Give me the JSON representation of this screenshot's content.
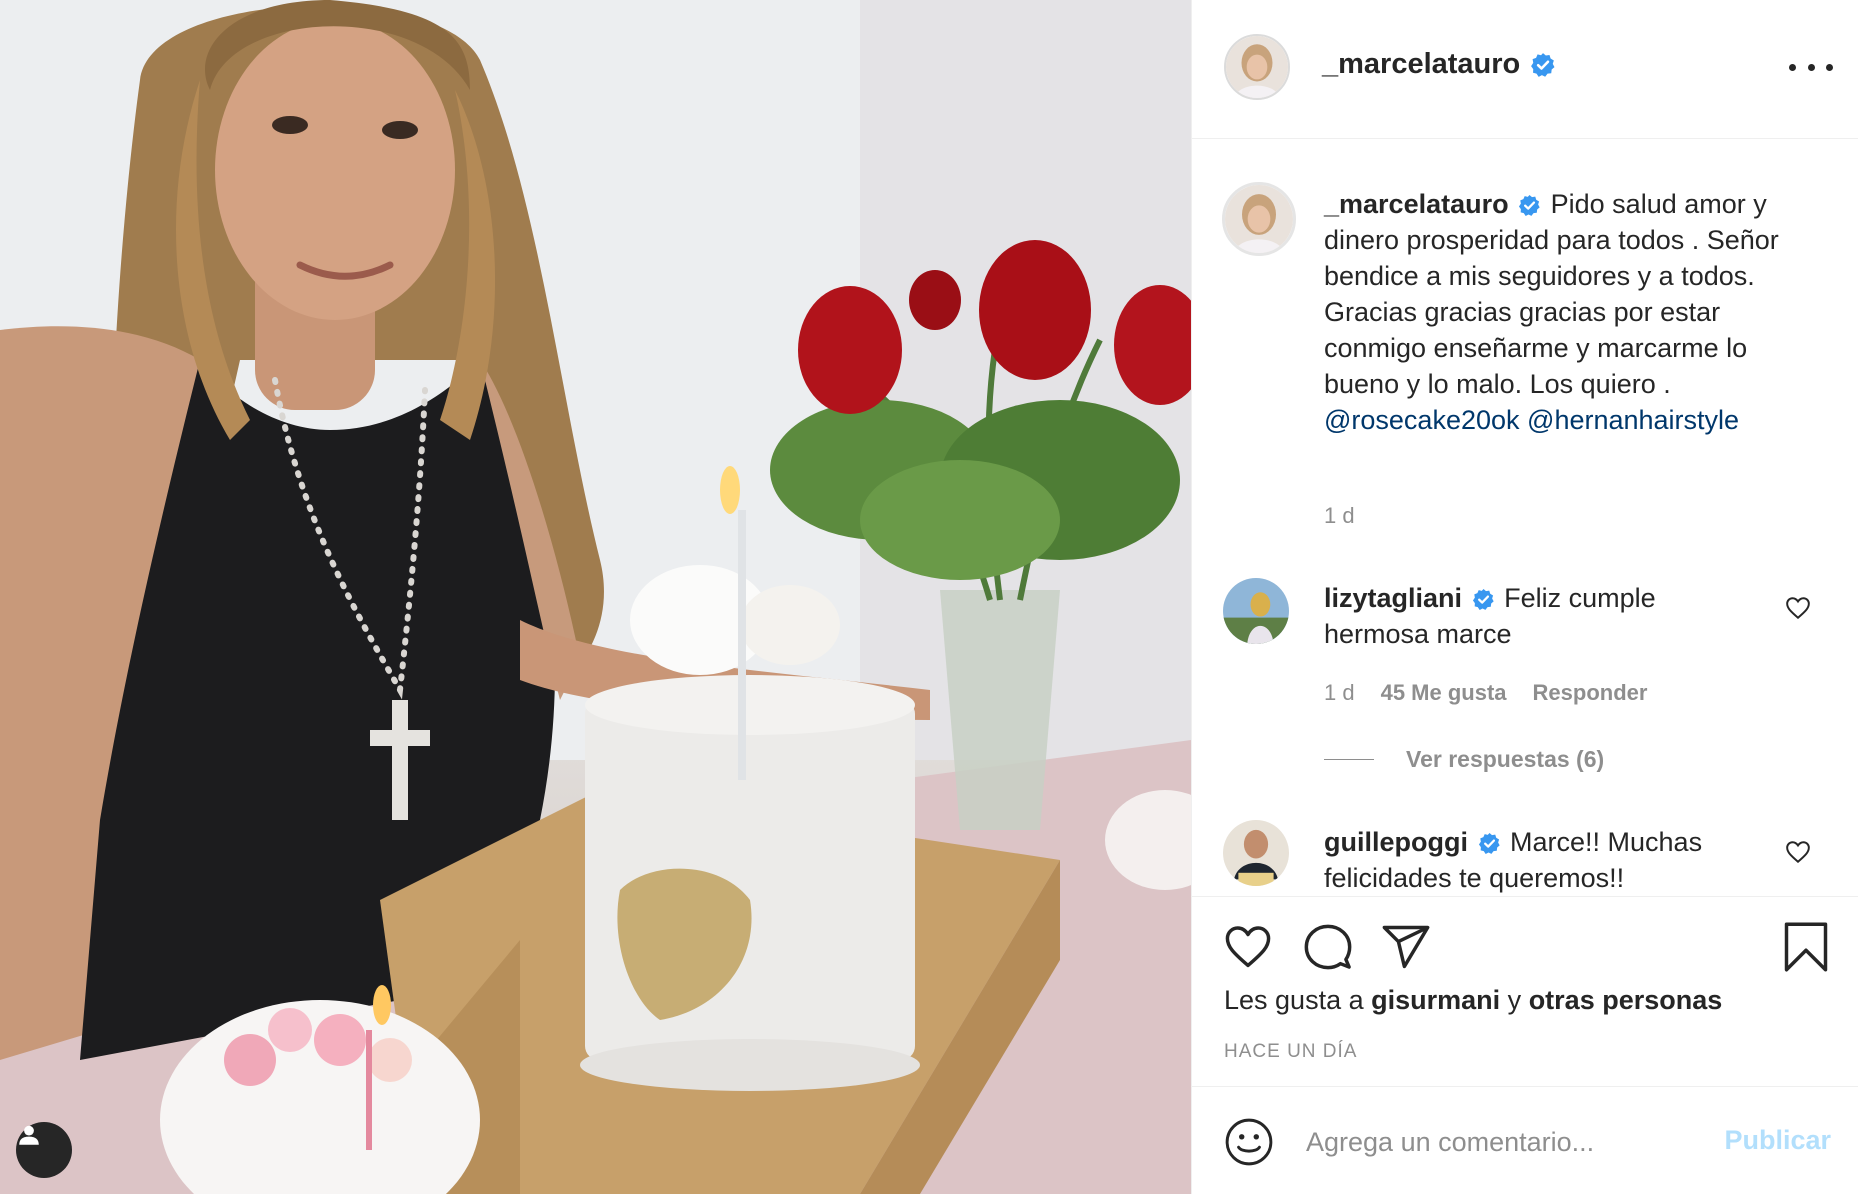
{
  "post": {
    "username": "_marcelatauro",
    "verified": true
  },
  "caption": {
    "username": "_marcelatauro",
    "text": "Pido salud amor y dinero prosperidad para todos . Señor bendice a mis seguidores y a todos. Gracias gracias gracias por estar conmigo enseñarme y marcarme lo bueno y lo malo. Los quiero .",
    "mentions": [
      "@rosecake20ok",
      "@hernanhairstyle"
    ],
    "time": "1 d"
  },
  "comments": [
    {
      "username": "lizytagliani",
      "text": "Feliz cumple hermosa marce",
      "time": "1 d",
      "likes": "45 Me gusta",
      "reply": "Responder",
      "view_replies": "Ver respuestas (6)"
    },
    {
      "username": "guillepoggi",
      "text": "Marce!! Muchas felicidades te queremos!!"
    }
  ],
  "likes": {
    "prefix": "Les gusta a",
    "user": "gisurmani",
    "joiner": "y",
    "others": "otras personas"
  },
  "timestamp": "HACE UN DÍA",
  "add_comment": {
    "placeholder": "Agrega un comentario...",
    "publish": "Publicar"
  },
  "colors": {
    "verified": "#3897f0",
    "mention": "#00376b",
    "secondary_text": "#8e8e8e",
    "publish_disabled": "#b2dffc"
  },
  "icons": [
    "user-tag-icon",
    "verified-icon",
    "more-options-icon",
    "heart-icon",
    "comment-icon",
    "share-icon",
    "bookmark-icon",
    "emoji-icon"
  ]
}
